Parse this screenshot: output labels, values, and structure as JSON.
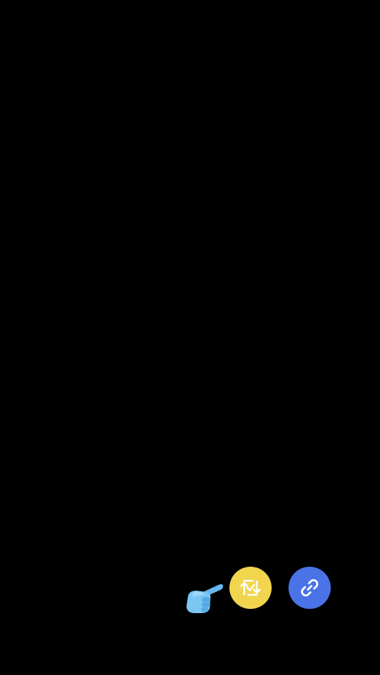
{
  "screen": {
    "background_color": "#000000"
  },
  "actions": {
    "hint_icon": "pointing-hand-icon",
    "swap": {
      "icon": "swap-arrows-icon",
      "color": "#F2D54E"
    },
    "link": {
      "icon": "link-icon",
      "color": "#4A73E8"
    }
  }
}
